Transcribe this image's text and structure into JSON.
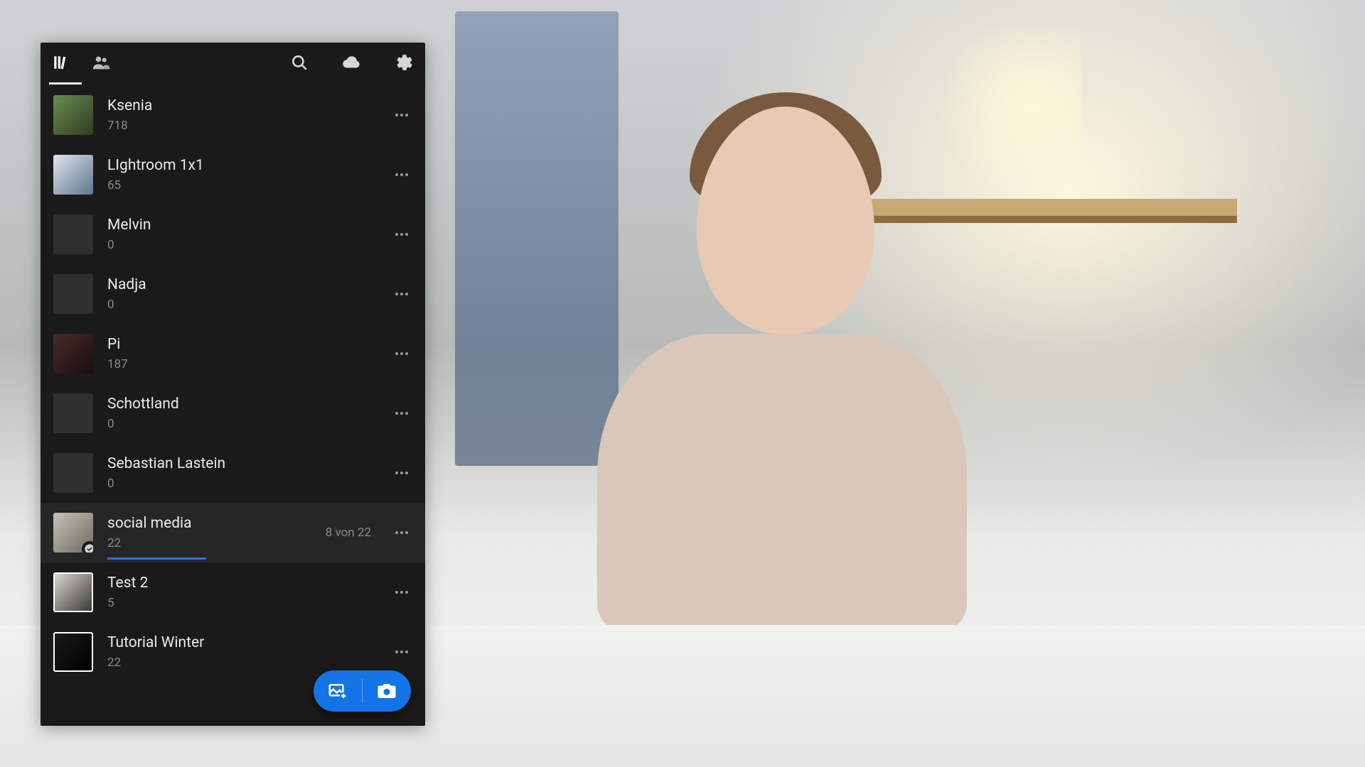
{
  "albums": [
    {
      "name": "Ksenia",
      "count": "718",
      "has_thumb": true,
      "thumb_variant": "v1",
      "selected": false,
      "status": "",
      "progress_pct": 0,
      "sync_badge": false
    },
    {
      "name": "LIghtroom 1x1",
      "count": "65",
      "has_thumb": true,
      "thumb_variant": "v2",
      "selected": false,
      "status": "",
      "progress_pct": 0,
      "sync_badge": false
    },
    {
      "name": "Melvin",
      "count": "0",
      "has_thumb": false,
      "thumb_variant": "",
      "selected": false,
      "status": "",
      "progress_pct": 0,
      "sync_badge": false
    },
    {
      "name": "Nadja",
      "count": "0",
      "has_thumb": false,
      "thumb_variant": "",
      "selected": false,
      "status": "",
      "progress_pct": 0,
      "sync_badge": false
    },
    {
      "name": "Pi",
      "count": "187",
      "has_thumb": true,
      "thumb_variant": "v3",
      "selected": false,
      "status": "",
      "progress_pct": 0,
      "sync_badge": false
    },
    {
      "name": "Schottland",
      "count": "0",
      "has_thumb": false,
      "thumb_variant": "",
      "selected": false,
      "status": "",
      "progress_pct": 0,
      "sync_badge": false
    },
    {
      "name": "Sebastian Lastein",
      "count": "0",
      "has_thumb": false,
      "thumb_variant": "",
      "selected": false,
      "status": "",
      "progress_pct": 0,
      "sync_badge": false
    },
    {
      "name": "social media",
      "count": "22",
      "has_thumb": true,
      "thumb_variant": "v4",
      "selected": true,
      "status": "8 von 22",
      "progress_pct": 36,
      "sync_badge": true
    },
    {
      "name": "Test 2",
      "count": "5",
      "has_thumb": true,
      "thumb_variant": "v5",
      "selected": false,
      "status": "",
      "progress_pct": 0,
      "sync_badge": false
    },
    {
      "name": "Tutorial Winter",
      "count": "22",
      "has_thumb": true,
      "thumb_variant": "v6",
      "selected": false,
      "status": "",
      "progress_pct": 0,
      "sync_badge": false
    }
  ],
  "colors": {
    "accent": "#1473e6",
    "progress": "#2e6fd6",
    "panel_bg": "#1a1a1a"
  },
  "icons": {
    "library": "library-icon",
    "people": "people-icon",
    "search": "search-icon",
    "cloud": "cloud-icon",
    "settings": "gear-icon",
    "more": "more-icon",
    "add_photo": "add-photo-icon",
    "camera": "camera-icon",
    "sync_done": "check-circle-icon"
  }
}
